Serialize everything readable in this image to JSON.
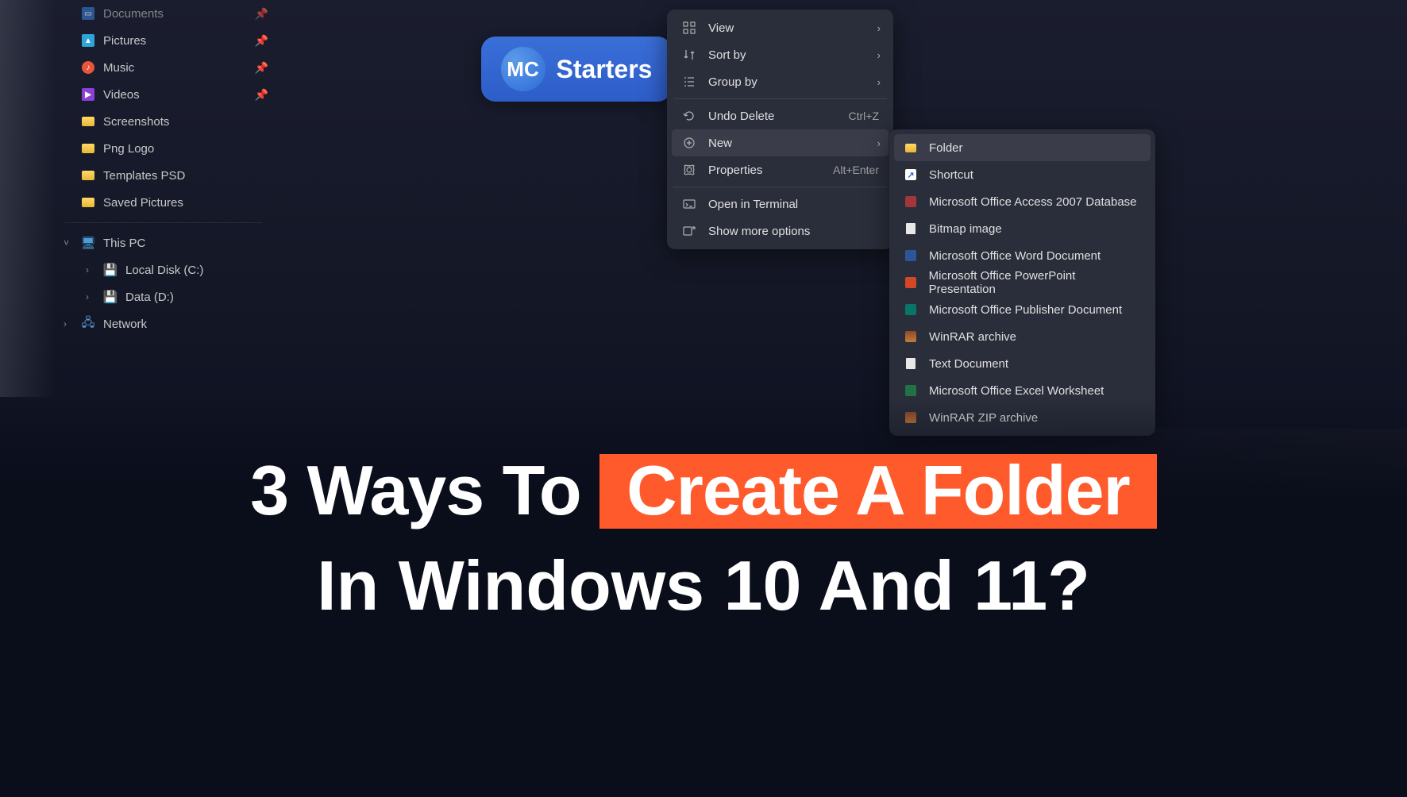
{
  "sidebar": {
    "quick": [
      {
        "label": "Documents",
        "icon": "documents",
        "pinned": true
      },
      {
        "label": "Pictures",
        "icon": "pictures",
        "pinned": true
      },
      {
        "label": "Music",
        "icon": "music",
        "pinned": true
      },
      {
        "label": "Videos",
        "icon": "videos",
        "pinned": true
      },
      {
        "label": "Screenshots",
        "icon": "folder",
        "pinned": false
      },
      {
        "label": "Png Logo",
        "icon": "folder",
        "pinned": false
      },
      {
        "label": "Templates PSD",
        "icon": "folder",
        "pinned": false
      },
      {
        "label": "Saved Pictures",
        "icon": "folder",
        "pinned": false
      }
    ],
    "this_pc": {
      "label": "This PC"
    },
    "drives": [
      {
        "label": "Local Disk (C:)"
      },
      {
        "label": "Data (D:)"
      }
    ],
    "network": {
      "label": "Network"
    }
  },
  "logo": {
    "mark": "MC",
    "text": "Starters"
  },
  "context_menu": [
    {
      "id": "view",
      "label": "View",
      "icon": "view",
      "submenu": true
    },
    {
      "id": "sort",
      "label": "Sort by",
      "icon": "sort",
      "submenu": true
    },
    {
      "id": "group",
      "label": "Group by",
      "icon": "group",
      "submenu": true
    },
    {
      "divider": true
    },
    {
      "id": "undo",
      "label": "Undo Delete",
      "icon": "undo",
      "shortcut": "Ctrl+Z"
    },
    {
      "id": "new",
      "label": "New",
      "icon": "new",
      "submenu": true,
      "highlighted": true
    },
    {
      "id": "properties",
      "label": "Properties",
      "icon": "properties",
      "shortcut": "Alt+Enter"
    },
    {
      "divider": true
    },
    {
      "id": "terminal",
      "label": "Open in Terminal",
      "icon": "terminal"
    },
    {
      "id": "more",
      "label": "Show more options",
      "icon": "more"
    }
  ],
  "new_submenu": [
    {
      "label": "Folder",
      "icon": "folder",
      "highlighted": true
    },
    {
      "label": "Shortcut",
      "icon": "shortcut"
    },
    {
      "label": "Microsoft Office Access 2007 Database",
      "icon": "access"
    },
    {
      "label": "Bitmap image",
      "icon": "bitmap"
    },
    {
      "label": "Microsoft Office Word Document",
      "icon": "word"
    },
    {
      "label": "Microsoft Office PowerPoint Presentation",
      "icon": "powerpoint"
    },
    {
      "label": "Microsoft Office Publisher Document",
      "icon": "publisher"
    },
    {
      "label": "WinRAR archive",
      "icon": "winrar"
    },
    {
      "label": "Text Document",
      "icon": "text"
    },
    {
      "label": "Microsoft Office Excel Worksheet",
      "icon": "excel"
    },
    {
      "label": "WinRAR ZIP archive",
      "icon": "winrarzip"
    }
  ],
  "title": {
    "line1a": "3 Ways To",
    "line1b": "Create A Folder",
    "line2": "In Windows 10 And 11?"
  }
}
